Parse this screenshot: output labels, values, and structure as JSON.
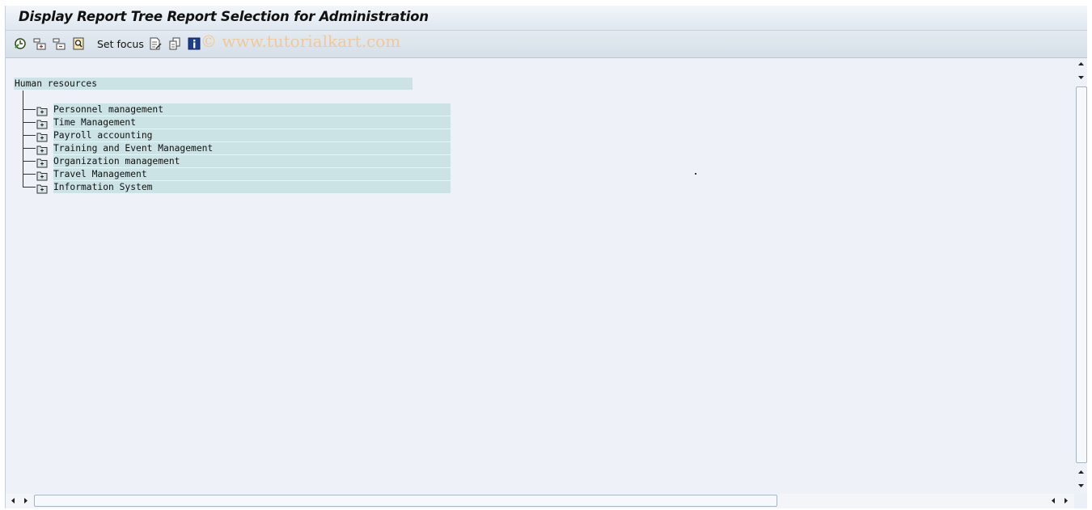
{
  "window": {
    "title": "Display Report Tree Report Selection for Administration"
  },
  "toolbar": {
    "buttons": [
      {
        "icon": "execute-clock-icon"
      },
      {
        "icon": "expand-subtree-icon"
      },
      {
        "icon": "collapse-subtree-icon"
      },
      {
        "icon": "find-icon"
      }
    ],
    "set_focus_label": "Set focus",
    "buttons_after": [
      {
        "icon": "edit-document-icon"
      },
      {
        "icon": "variants-icon"
      },
      {
        "icon": "info-icon"
      }
    ]
  },
  "watermark": "© www.tutorialkart.com",
  "tree": {
    "root": "Human resources",
    "children": [
      "Personnel management",
      "Time Management",
      "Payroll accounting",
      "Training and Event Management",
      "Organization management",
      "Travel Management",
      "Information System"
    ]
  }
}
